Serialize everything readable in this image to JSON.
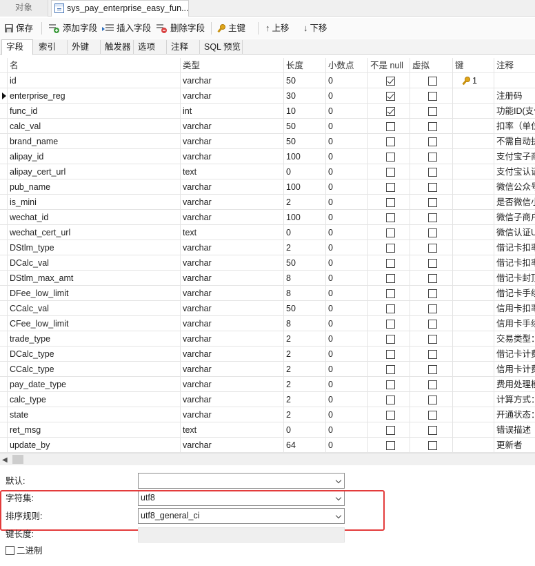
{
  "top_tabs": [
    {
      "label": "对象",
      "active": false
    },
    {
      "label": "sys_pay_enterprise_easy_fun...",
      "active": true
    }
  ],
  "toolbar": {
    "save": "保存",
    "add_field": "添加字段",
    "insert_field": "插入字段",
    "delete_field": "删除字段",
    "primary_key": "主键",
    "move_up": "上移",
    "move_down": "下移"
  },
  "sub_tabs": [
    {
      "label": "字段",
      "active": true
    },
    {
      "label": "索引",
      "active": false
    },
    {
      "label": "外键",
      "active": false
    },
    {
      "label": "触发器",
      "active": false
    },
    {
      "label": "选项",
      "active": false
    },
    {
      "label": "注释",
      "active": false
    },
    {
      "label": "SQL 预览",
      "active": false
    }
  ],
  "grid": {
    "headers": {
      "name": "名",
      "type": "类型",
      "length": "长度",
      "decimals": "小数点",
      "not_null": "不是 null",
      "virtual": "虚拟",
      "key": "键",
      "comment": "注释"
    },
    "current_row": 1,
    "rows": [
      {
        "name": "id",
        "type": "varchar",
        "length": "50",
        "decimals": "0",
        "not_null": true,
        "virtual": false,
        "key": "1",
        "comment": ""
      },
      {
        "name": "enterprise_reg",
        "type": "varchar",
        "length": "30",
        "decimals": "0",
        "not_null": true,
        "virtual": false,
        "key": "",
        "comment": "注册码"
      },
      {
        "name": "func_id",
        "type": "int",
        "length": "10",
        "decimals": "0",
        "not_null": true,
        "virtual": false,
        "key": "",
        "comment": "功能ID(支付"
      },
      {
        "name": "calc_val",
        "type": "varchar",
        "length": "50",
        "decimals": "0",
        "not_null": false,
        "virtual": false,
        "key": "",
        "comment": "扣率（单位"
      },
      {
        "name": "brand_name",
        "type": "varchar",
        "length": "50",
        "decimals": "0",
        "not_null": false,
        "virtual": false,
        "key": "",
        "comment": "不需自动执"
      },
      {
        "name": "alipay_id",
        "type": "varchar",
        "length": "100",
        "decimals": "0",
        "not_null": false,
        "virtual": false,
        "key": "",
        "comment": "支付宝子商"
      },
      {
        "name": "alipay_cert_url",
        "type": "text",
        "length": "0",
        "decimals": "0",
        "not_null": false,
        "virtual": false,
        "key": "",
        "comment": "支付宝认证"
      },
      {
        "name": "pub_name",
        "type": "varchar",
        "length": "100",
        "decimals": "0",
        "not_null": false,
        "virtual": false,
        "key": "",
        "comment": "微信公众号"
      },
      {
        "name": "is_mini",
        "type": "varchar",
        "length": "2",
        "decimals": "0",
        "not_null": false,
        "virtual": false,
        "key": "",
        "comment": "是否微信小"
      },
      {
        "name": "wechat_id",
        "type": "varchar",
        "length": "100",
        "decimals": "0",
        "not_null": false,
        "virtual": false,
        "key": "",
        "comment": "微信子商户"
      },
      {
        "name": "wechat_cert_url",
        "type": "text",
        "length": "0",
        "decimals": "0",
        "not_null": false,
        "virtual": false,
        "key": "",
        "comment": "微信认证U"
      },
      {
        "name": "DStlm_type",
        "type": "varchar",
        "length": "2",
        "decimals": "0",
        "not_null": false,
        "virtual": false,
        "key": "",
        "comment": "借记卡扣率"
      },
      {
        "name": "DCalc_val",
        "type": "varchar",
        "length": "50",
        "decimals": "0",
        "not_null": false,
        "virtual": false,
        "key": "",
        "comment": "借记卡扣率"
      },
      {
        "name": "DStlm_max_amt",
        "type": "varchar",
        "length": "8",
        "decimals": "0",
        "not_null": false,
        "virtual": false,
        "key": "",
        "comment": "借记卡封顶"
      },
      {
        "name": "DFee_low_limit",
        "type": "varchar",
        "length": "8",
        "decimals": "0",
        "not_null": false,
        "virtual": false,
        "key": "",
        "comment": "借记卡手续"
      },
      {
        "name": "CCalc_val",
        "type": "varchar",
        "length": "50",
        "decimals": "0",
        "not_null": false,
        "virtual": false,
        "key": "",
        "comment": "信用卡扣率"
      },
      {
        "name": "CFee_low_limit",
        "type": "varchar",
        "length": "8",
        "decimals": "0",
        "not_null": false,
        "virtual": false,
        "key": "",
        "comment": "信用卡手续"
      },
      {
        "name": "trade_type",
        "type": "varchar",
        "length": "2",
        "decimals": "0",
        "not_null": false,
        "virtual": false,
        "key": "",
        "comment": "交易类型："
      },
      {
        "name": "DCalc_type",
        "type": "varchar",
        "length": "2",
        "decimals": "0",
        "not_null": false,
        "virtual": false,
        "key": "",
        "comment": "借记卡计费"
      },
      {
        "name": "CCalc_type",
        "type": "varchar",
        "length": "2",
        "decimals": "0",
        "not_null": false,
        "virtual": false,
        "key": "",
        "comment": "信用卡计费"
      },
      {
        "name": "pay_date_type",
        "type": "varchar",
        "length": "2",
        "decimals": "0",
        "not_null": false,
        "virtual": false,
        "key": "",
        "comment": "费用处理模"
      },
      {
        "name": "calc_type",
        "type": "varchar",
        "length": "2",
        "decimals": "0",
        "not_null": false,
        "virtual": false,
        "key": "",
        "comment": "计算方式："
      },
      {
        "name": "state",
        "type": "varchar",
        "length": "2",
        "decimals": "0",
        "not_null": false,
        "virtual": false,
        "key": "",
        "comment": "开通状态："
      },
      {
        "name": "ret_msg",
        "type": "text",
        "length": "0",
        "decimals": "0",
        "not_null": false,
        "virtual": false,
        "key": "",
        "comment": "错误描述"
      },
      {
        "name": "update_by",
        "type": "varchar",
        "length": "64",
        "decimals": "0",
        "not_null": false,
        "virtual": false,
        "key": "",
        "comment": "更新者"
      }
    ]
  },
  "properties": {
    "default_label": "默认:",
    "default_value": "",
    "charset_label": "字符集:",
    "charset_value": "utf8",
    "collation_label": "排序规则:",
    "collation_value": "utf8_general_ci",
    "key_length_label": "键长度:",
    "binary_label": "二进制",
    "binary_checked": false
  },
  "colors": {
    "highlight_border": "#e33b3b",
    "key_gold": "#e0a619"
  }
}
